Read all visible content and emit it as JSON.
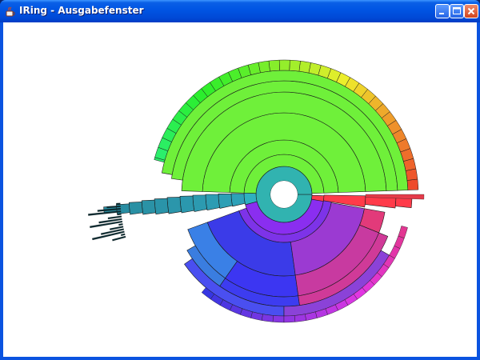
{
  "window": {
    "title": "IRing - Ausgabefenster",
    "icon": "java-cup-icon",
    "controls": [
      "minimize-icon",
      "maximize-icon",
      "close-icon"
    ]
  },
  "colors": {
    "titlebar": "#0054e3",
    "client_background": "#ffffff",
    "segment_stroke": "#1a1a1a"
  }
}
